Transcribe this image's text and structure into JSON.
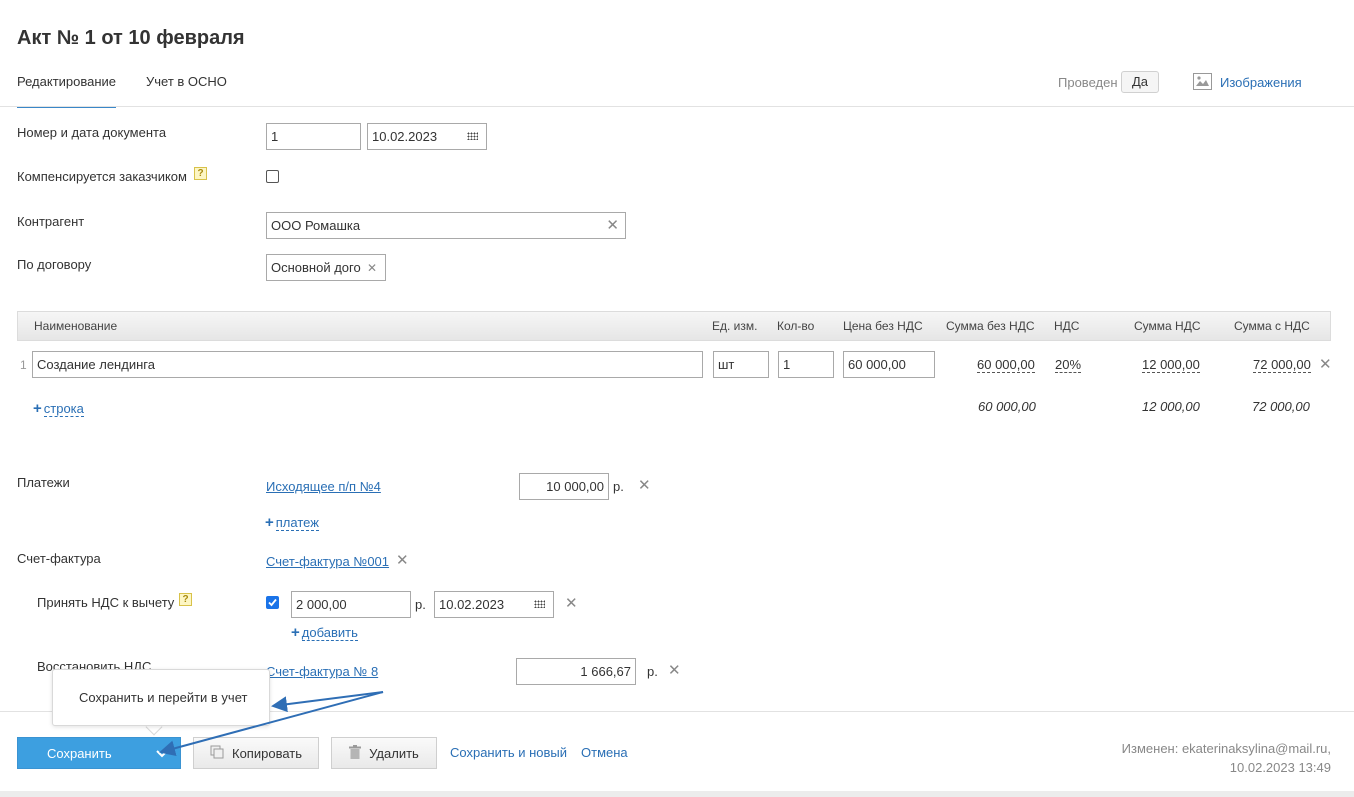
{
  "header": {
    "title": "Акт № 1 от 10 февраля",
    "tabs": [
      "Редактирование",
      "Учет в ОСНО"
    ],
    "posted_label": "Проведен",
    "posted_value": "Да",
    "images_link": "Изображения"
  },
  "form": {
    "doc_label": "Номер и дата документа",
    "doc_number": "1",
    "doc_date": "10.02.2023",
    "compensated_label": "Компенсируется заказчиком",
    "help_mark": "?",
    "counterparty_label": "Контрагент",
    "counterparty_value": "ООО Ромашка",
    "contract_label": "По договору",
    "contract_value": "Основной дого"
  },
  "table": {
    "headers": [
      "Наименование",
      "Ед. изм.",
      "Кол-во",
      "Цена без НДС",
      "Сумма без НДС",
      "НДС",
      "Сумма НДС",
      "Сумма с НДС"
    ],
    "rows": [
      {
        "index": "1",
        "name": "Создание лендинга",
        "unit": "шт",
        "qty": "1",
        "price": "60 000,00",
        "sum_no_vat": "60 000,00",
        "vat": "20%",
        "vat_sum": "12 000,00",
        "total": "72 000,00"
      }
    ],
    "add_row_label": "строка",
    "totals": {
      "sum_no_vat": "60 000,00",
      "vat_sum": "12 000,00",
      "total": "72 000,00"
    }
  },
  "payments": {
    "label": "Платежи",
    "doc_link": "Исходящее п/п №4",
    "amount": "10 000,00",
    "currency": "р.",
    "add_label": "платеж"
  },
  "invoice": {
    "label": "Счет-фактура",
    "link": "Счет-фактура №001",
    "accept_vat_label": "Принять НДС к вычету",
    "accept_vat_amount": "2 000,00",
    "accept_vat_currency": "р.",
    "accept_vat_date": "10.02.2023",
    "add_label": "добавить",
    "restore_vat_label": "Восстановить НДС",
    "restore_vat_link": "Счет-фактура № 8",
    "restore_vat_amount": "1 666,67",
    "restore_vat_currency": "р."
  },
  "tooltip": {
    "text": "Сохранить и перейти в учет"
  },
  "footer": {
    "save_label": "Сохранить",
    "copy_label": "Копировать",
    "delete_label": "Удалить",
    "save_new_label": "Сохранить и новый",
    "cancel_label": "Отмена",
    "modified_line1": "Изменен: ekaterinaksylina@mail.ru,",
    "modified_line2": "10.02.2023 13:49"
  },
  "colors": {
    "accent": "#3d9fe0",
    "link": "#2a6fb5",
    "annotation_arrow": "#2f6eb5"
  }
}
